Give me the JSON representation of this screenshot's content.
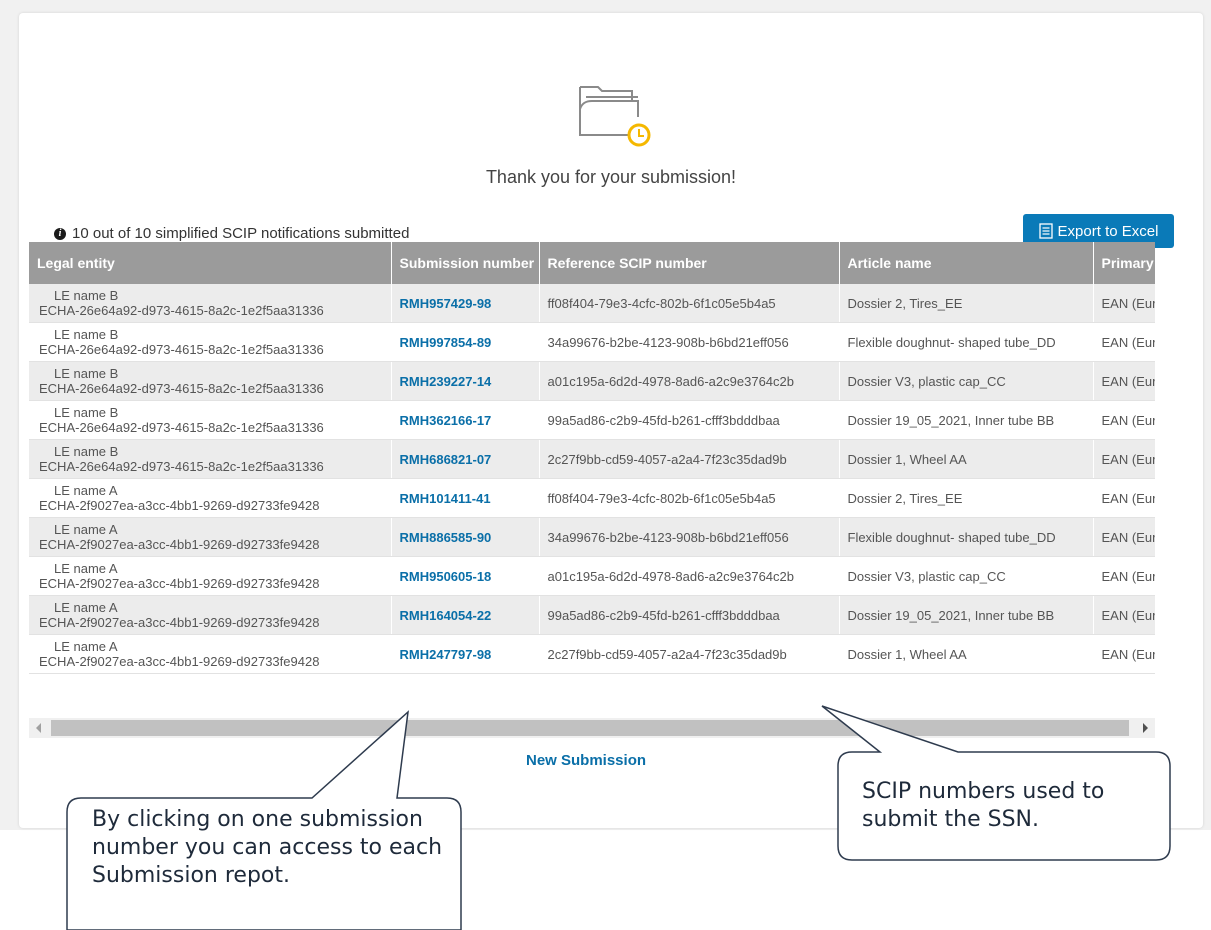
{
  "page": {
    "thank_you": "Thank you for your submission!",
    "info_text": "10 out of 10 simplified SCIP notifications submitted",
    "export_label": "Export to Excel",
    "new_submission_label": "New Submission"
  },
  "table": {
    "headers": [
      "Legal entity",
      "Submission number",
      "Reference SCIP number",
      "Article name",
      "Primary a"
    ],
    "rows": [
      {
        "le_name": "LE name B",
        "le_id": "ECHA-26e64a92-d973-4615-8a2c-1e2f5aa31336",
        "submission": "RMH957429-98",
        "scip": "ff08f404-79e3-4cfc-802b-6f1c05e5b4a5",
        "article": "Dossier 2, Tires_EE",
        "primary": "EAN (Europ"
      },
      {
        "le_name": "LE name B",
        "le_id": "ECHA-26e64a92-d973-4615-8a2c-1e2f5aa31336",
        "submission": "RMH997854-89",
        "scip": "34a99676-b2be-4123-908b-b6bd21eff056",
        "article": "Flexible doughnut- shaped tube_DD",
        "primary": "EAN (Europ"
      },
      {
        "le_name": "LE name B",
        "le_id": "ECHA-26e64a92-d973-4615-8a2c-1e2f5aa31336",
        "submission": "RMH239227-14",
        "scip": "a01c195a-6d2d-4978-8ad6-a2c9e3764c2b",
        "article": "Dossier V3, plastic cap_CC",
        "primary": "EAN (Europ"
      },
      {
        "le_name": "LE name B",
        "le_id": "ECHA-26e64a92-d973-4615-8a2c-1e2f5aa31336",
        "submission": "RMH362166-17",
        "scip": "99a5ad86-c2b9-45fd-b261-cfff3bdddbaa",
        "article": "Dossier 19_05_2021, Inner tube BB",
        "primary": "EAN (Europ"
      },
      {
        "le_name": "LE name B",
        "le_id": "ECHA-26e64a92-d973-4615-8a2c-1e2f5aa31336",
        "submission": "RMH686821-07",
        "scip": "2c27f9bb-cd59-4057-a2a4-7f23c35dad9b",
        "article": "Dossier 1, Wheel AA",
        "primary": "EAN (Europ"
      },
      {
        "le_name": "LE name A",
        "le_id": "ECHA-2f9027ea-a3cc-4bb1-9269-d92733fe9428",
        "submission": "RMH101411-41",
        "scip": "ff08f404-79e3-4cfc-802b-6f1c05e5b4a5",
        "article": "Dossier 2, Tires_EE",
        "primary": "EAN (Europ"
      },
      {
        "le_name": "LE name A",
        "le_id": "ECHA-2f9027ea-a3cc-4bb1-9269-d92733fe9428",
        "submission": "RMH886585-90",
        "scip": "34a99676-b2be-4123-908b-b6bd21eff056",
        "article": "Flexible doughnut- shaped tube_DD",
        "primary": "EAN (Europ"
      },
      {
        "le_name": "LE name A",
        "le_id": "ECHA-2f9027ea-a3cc-4bb1-9269-d92733fe9428",
        "submission": "RMH950605-18",
        "scip": "a01c195a-6d2d-4978-8ad6-a2c9e3764c2b",
        "article": "Dossier V3, plastic cap_CC",
        "primary": "EAN (Europ"
      },
      {
        "le_name": "LE name A",
        "le_id": "ECHA-2f9027ea-a3cc-4bb1-9269-d92733fe9428",
        "submission": "RMH164054-22",
        "scip": "99a5ad86-c2b9-45fd-b261-cfff3bdddbaa",
        "article": "Dossier 19_05_2021, Inner tube BB",
        "primary": "EAN (Europ"
      },
      {
        "le_name": "LE name A",
        "le_id": "ECHA-2f9027ea-a3cc-4bb1-9269-d92733fe9428",
        "submission": "RMH247797-98",
        "scip": "2c27f9bb-cd59-4057-a2a4-7f23c35dad9b",
        "article": "Dossier 1, Wheel AA",
        "primary": "EAN (Europ"
      }
    ]
  },
  "callouts": {
    "left": "By clicking on one submission number you can access to each Submission repot.",
    "right": "SCIP numbers used to submit the SSN."
  },
  "colors": {
    "accent": "#0a7ab8",
    "header_bg": "#9b9b9b",
    "row_alt": "#ececec",
    "clock_badge": "#f5b800"
  },
  "icons": {
    "hero": "folder-clock-icon",
    "info": "info-icon",
    "export": "spreadsheet-icon"
  }
}
